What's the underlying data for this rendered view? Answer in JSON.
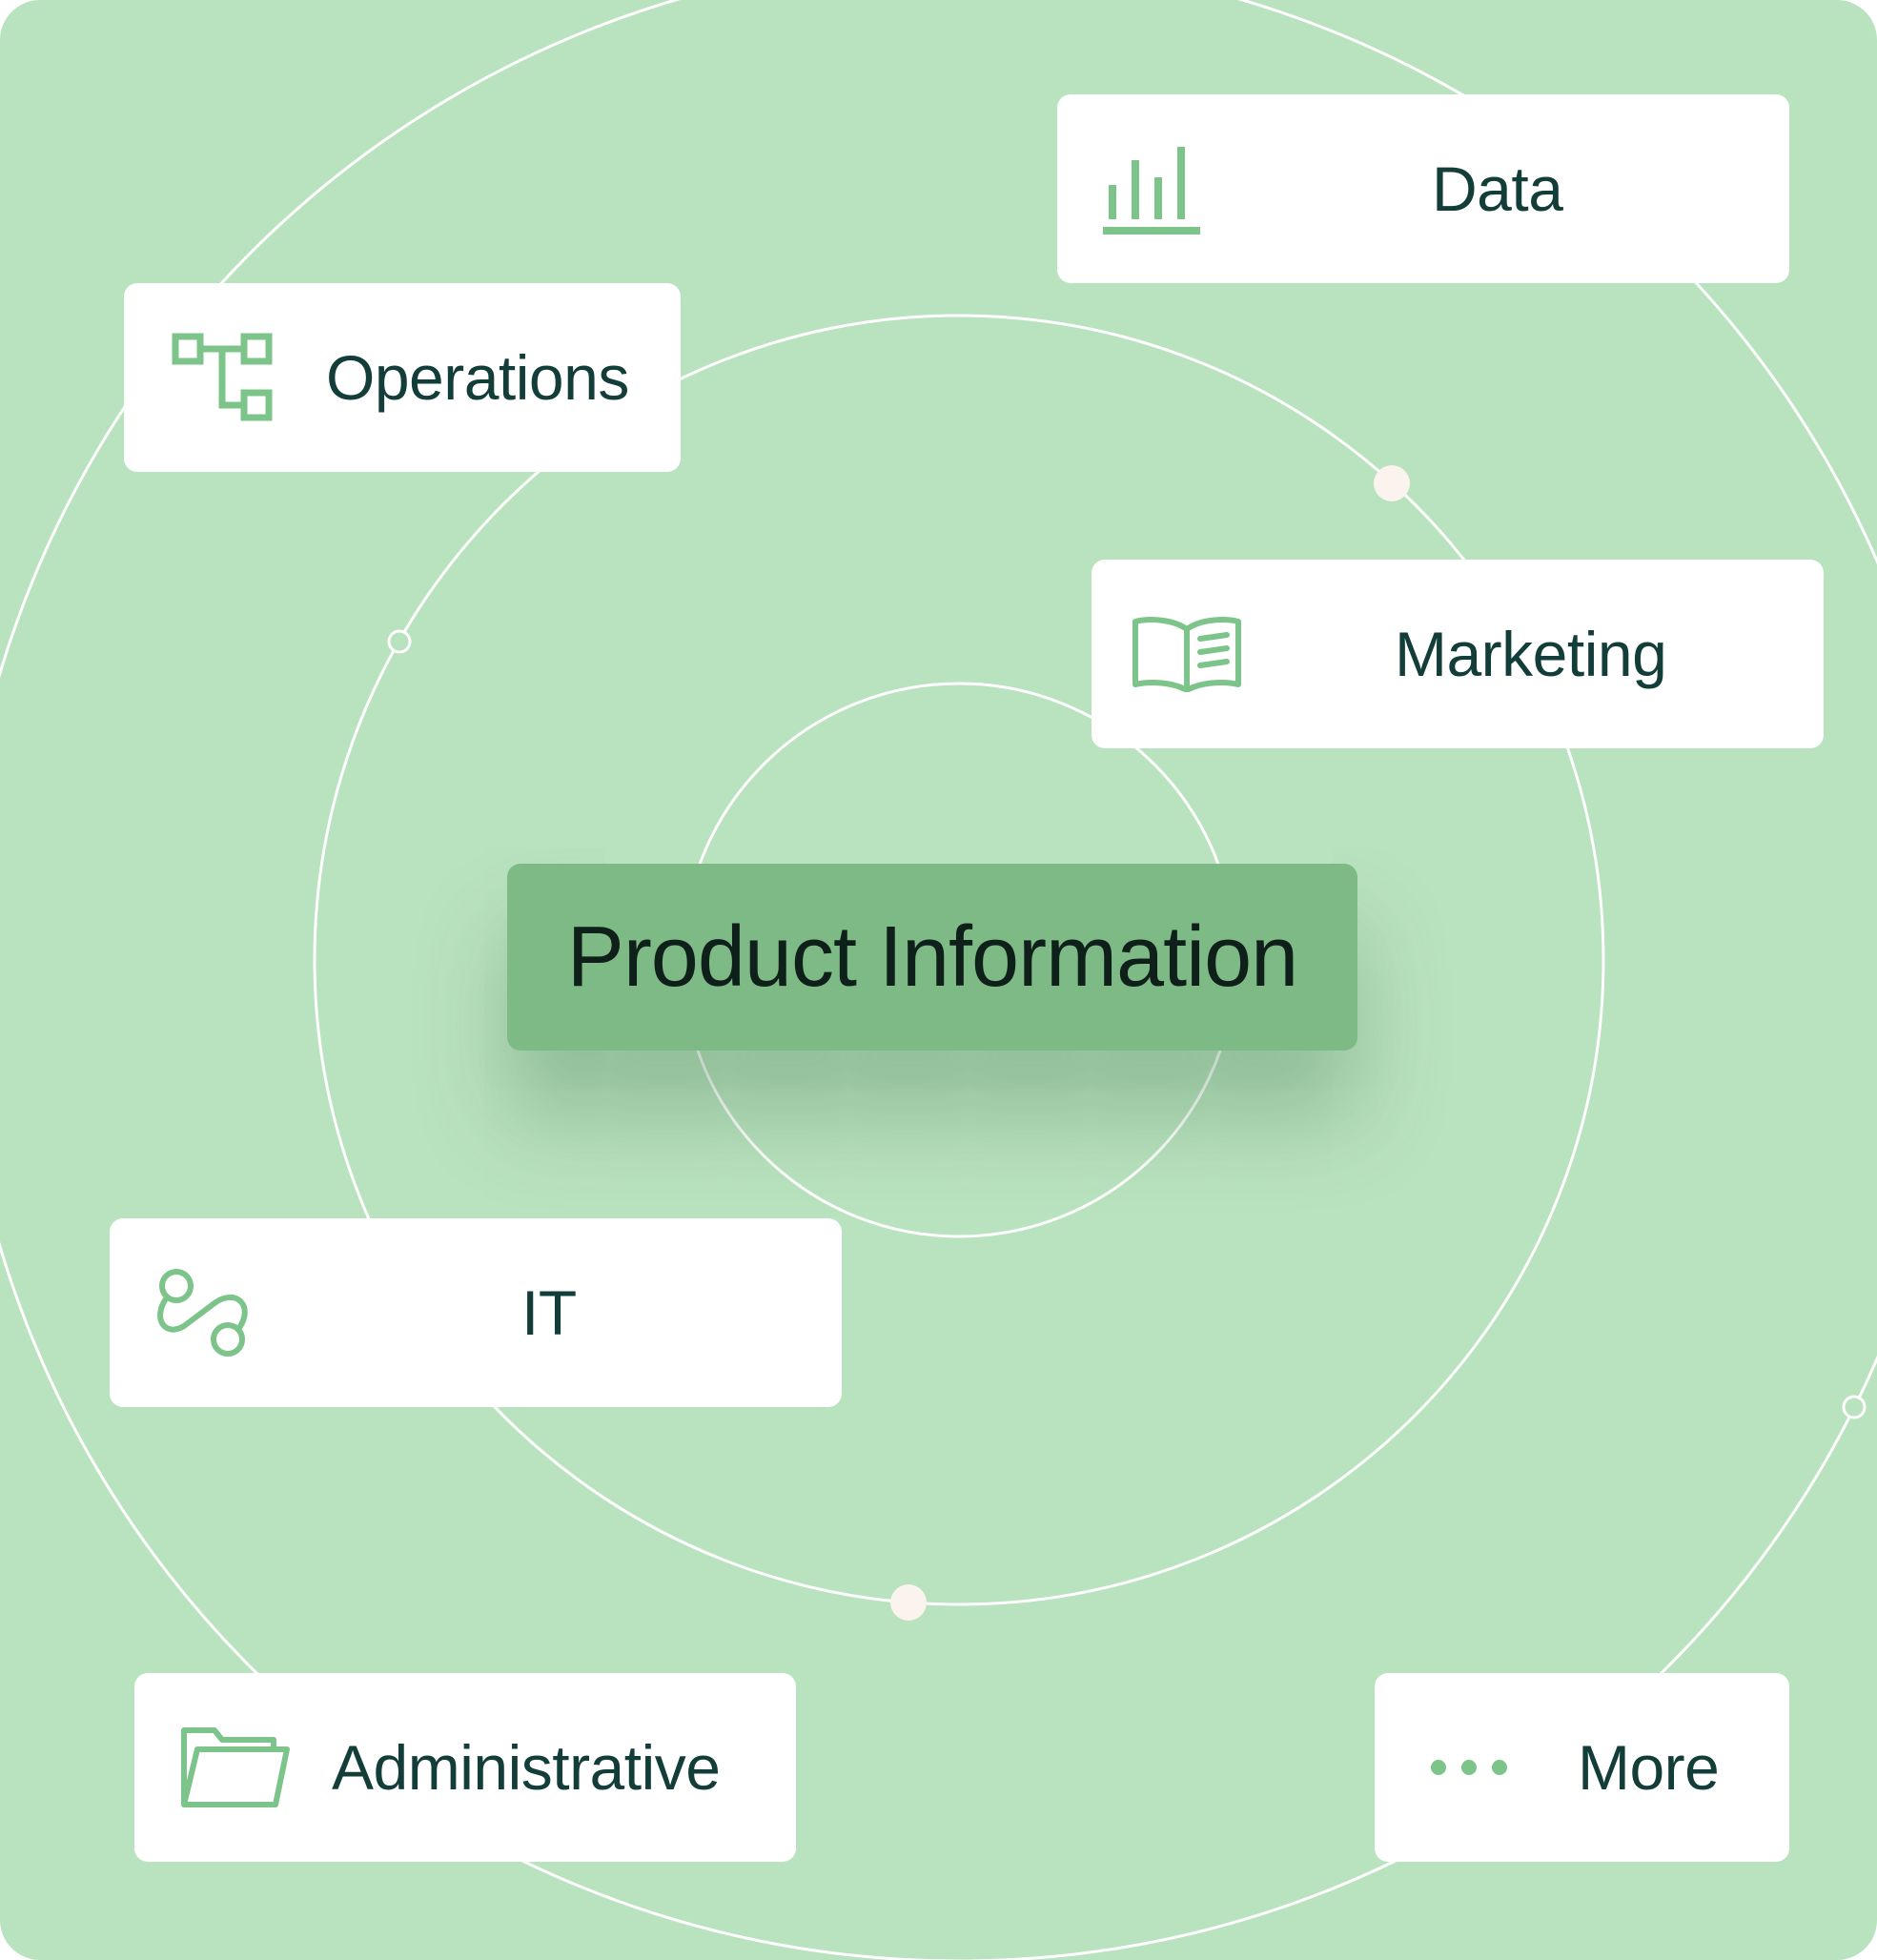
{
  "diagram": {
    "center": {
      "label": "Product Information"
    },
    "nodes": [
      {
        "id": "data",
        "label": "Data",
        "icon": "bar-chart-icon"
      },
      {
        "id": "operations",
        "label": "Operations",
        "icon": "hierarchy-icon"
      },
      {
        "id": "marketing",
        "label": "Marketing",
        "icon": "open-book-icon"
      },
      {
        "id": "it",
        "label": "IT",
        "icon": "route-icon"
      },
      {
        "id": "administrative",
        "label": "Administrative",
        "icon": "folder-icon"
      },
      {
        "id": "more",
        "label": "More",
        "icon": "more-dots-icon"
      }
    ]
  },
  "colors": {
    "background": "#b9e2be",
    "center_fill": "#7dba85",
    "card": "#ffffff",
    "text": "#123d38",
    "icon": "#7cc48a",
    "orbit_line": "#ffffff",
    "orbit_dot": "#fbf3ee"
  }
}
